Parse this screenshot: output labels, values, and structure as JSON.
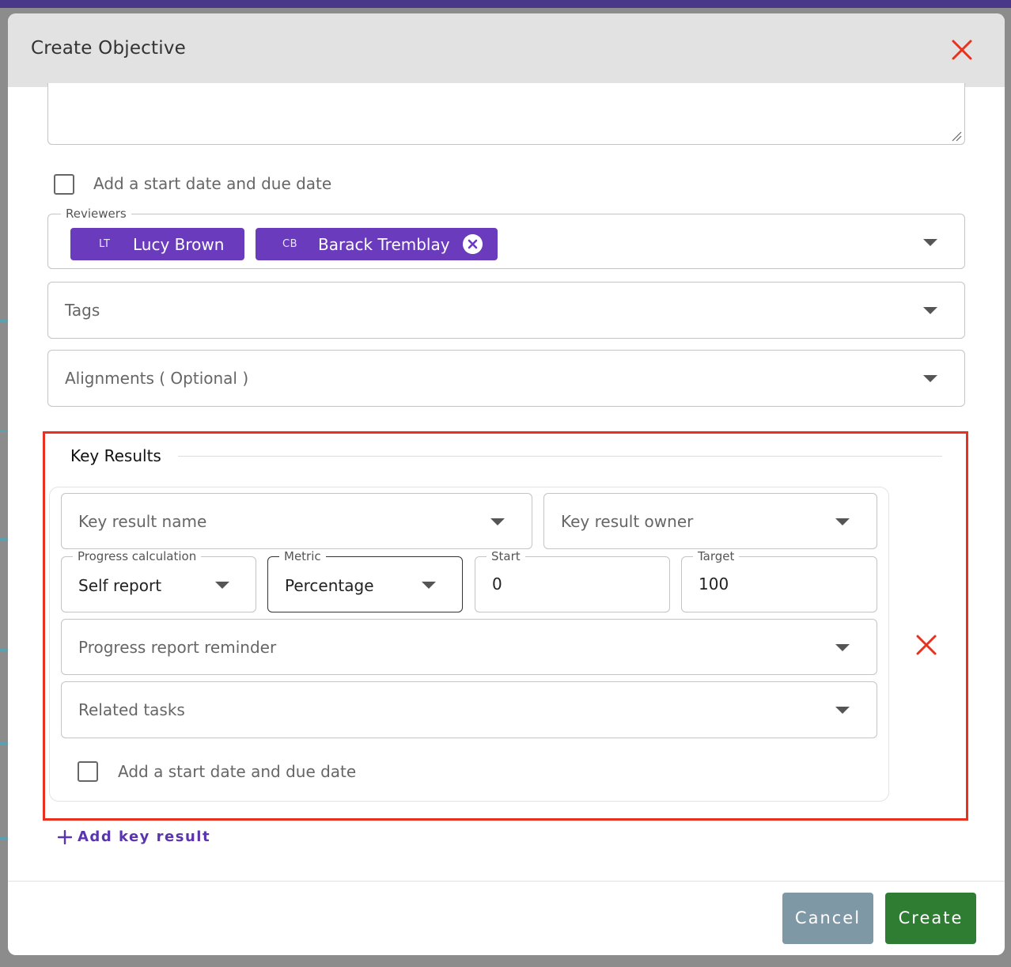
{
  "modal": {
    "title": "Create Objective"
  },
  "form": {
    "date_checkbox_label": "Add a start date and due date",
    "reviewers": {
      "legend": "Reviewers",
      "chips": [
        {
          "initials": "LT",
          "name": "Lucy Brown"
        },
        {
          "initials": "CB",
          "name": "Barack Tremblay"
        }
      ]
    },
    "tags_placeholder": "Tags",
    "alignments_placeholder": "Alignments ( Optional )"
  },
  "key_results": {
    "title": "Key Results",
    "name_placeholder": "Key result name",
    "owner_placeholder": "Key result owner",
    "progress_calculation": {
      "legend": "Progress calculation",
      "value": "Self report"
    },
    "metric": {
      "legend": "Metric",
      "value": "Percentage"
    },
    "start": {
      "legend": "Start",
      "value": "0"
    },
    "target": {
      "legend": "Target",
      "value": "100"
    },
    "reminder_placeholder": "Progress report reminder",
    "related_tasks_placeholder": "Related tasks",
    "date_checkbox_label": "Add a start date and due date",
    "add_label": "Add key result"
  },
  "footer": {
    "cancel_label": "Cancel",
    "create_label": "Create"
  },
  "colors": {
    "brand_purple": "#6a3bbd",
    "danger_red": "#e8321e",
    "create_green": "#2e7d32",
    "cancel_gray": "#7f98a6"
  }
}
